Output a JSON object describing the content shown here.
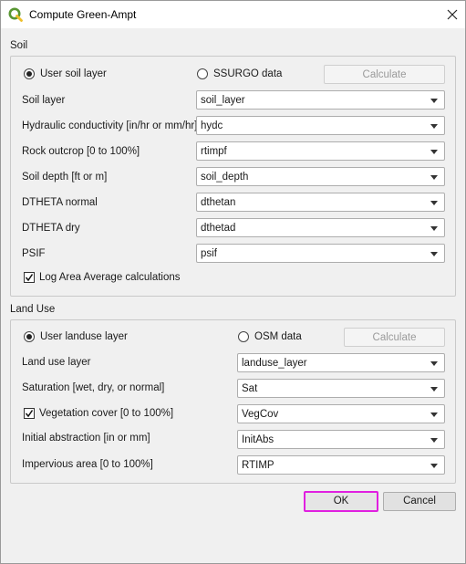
{
  "window": {
    "title": "Compute Green-Ampt",
    "close_icon": "close-icon",
    "app_icon": "qgis-logo-icon"
  },
  "soil": {
    "section_label": "Soil",
    "radio_user": "User soil layer",
    "radio_ssurgo": "SSURGO data",
    "selected_source": "User soil layer",
    "calculate_label": "Calculate",
    "fields": [
      {
        "label": "Soil layer",
        "value": "soil_layer"
      },
      {
        "label": "Hydraulic conductivity [in/hr or mm/hr]",
        "value": "hydc"
      },
      {
        "label": "Rock outcrop [0 to 100%]",
        "value": "rtimpf"
      },
      {
        "label": "Soil depth [ft or m]",
        "value": "soil_depth"
      },
      {
        "label": "DTHETA normal",
        "value": "dthetan"
      },
      {
        "label": "DTHETA dry",
        "value": "dthetad"
      },
      {
        "label": "PSIF",
        "value": "psif"
      }
    ],
    "log_area_label": "Log Area Average calculations",
    "log_area_checked": true
  },
  "landuse": {
    "section_label": "Land Use",
    "radio_user": "User landuse layer",
    "radio_osm": "OSM data",
    "selected_source": "User landuse layer",
    "calculate_label": "Calculate",
    "fields": [
      {
        "label": "Land use layer",
        "value": "landuse_layer"
      },
      {
        "label": "Saturation [wet, dry, or normal]",
        "value": "Sat"
      },
      {
        "label": "Vegetation cover [0 to 100%]",
        "value": "VegCov",
        "checkbox": true
      },
      {
        "label": "Initial abstraction [in or mm]",
        "value": "InitAbs"
      },
      {
        "label": "Impervious area [0 to 100%]",
        "value": "RTIMP"
      }
    ]
  },
  "footer": {
    "ok_label": "OK",
    "cancel_label": "Cancel"
  },
  "colors": {
    "ok_highlight": "#e020e0",
    "qgis_green": "#589632",
    "qgis_yellow": "#eebf2a"
  }
}
